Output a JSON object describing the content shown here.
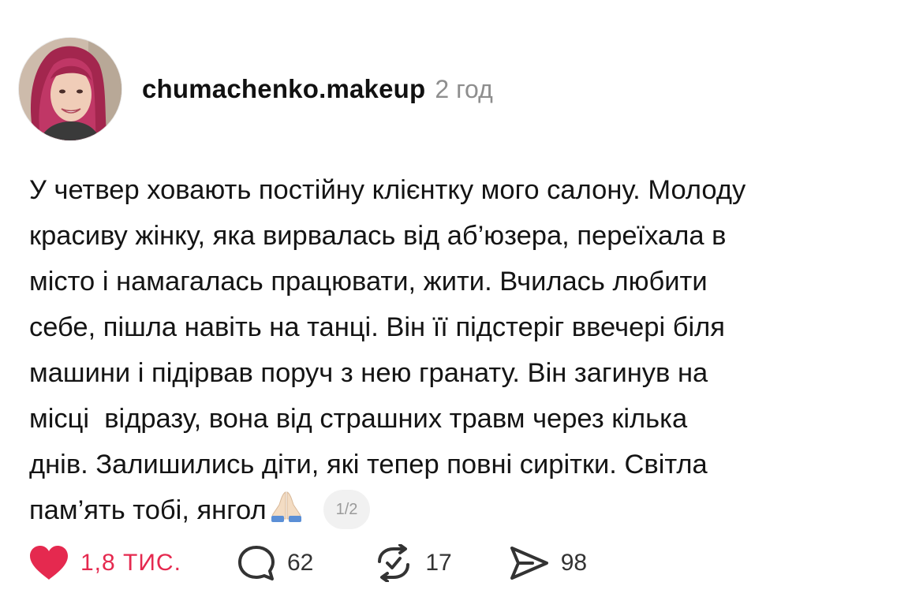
{
  "post": {
    "author": "chumachenko.makeup",
    "time": "2 год",
    "text": "У четвер ховають постійну клієнтку мого салону. Молоду\nкрасиву жінку, яка вирвалась від аб’юзера, переїхала в\nмісто і намагалась працювати, жити. Вчилась любити\nсебе, пішла навіть на танці. Він її підстеріг ввечері біля\nмашини і підірвав поруч з нею гранату. Він загинув на\nмісці  відразу, вона від страшних травм через кілька\nднів. Залишились діти, які тепер повні сирітки. Світла\nпам’ять тобі, янгол",
    "page_indicator": "1/2"
  },
  "actions": {
    "likes": "1,8 ТИС.",
    "replies": "62",
    "reposts": "17",
    "shares": "98"
  },
  "colors": {
    "like": "#e5294f",
    "muted": "#8e8e8e",
    "text": "#141414"
  },
  "icons": {
    "like": "heart-icon",
    "reply": "comment-bubble-icon",
    "repost": "repost-icon",
    "share": "send-icon",
    "emoji": "praying-hands-emoji"
  }
}
